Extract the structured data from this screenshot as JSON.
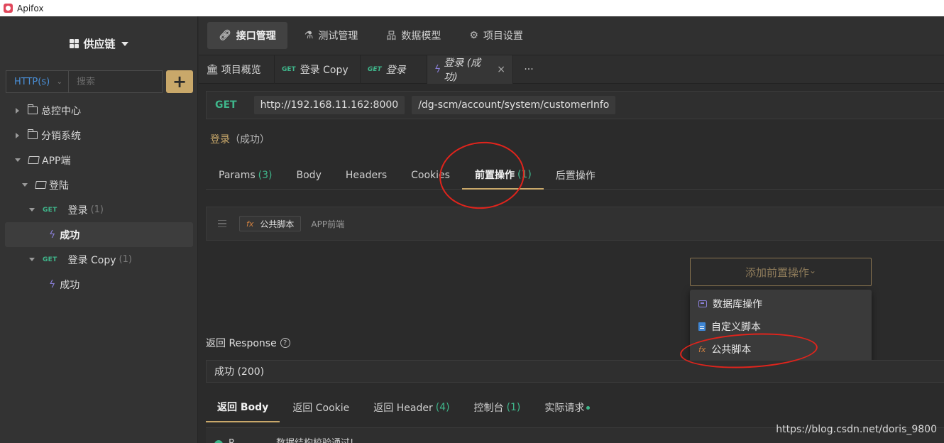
{
  "window": {
    "title": "Apifox"
  },
  "sidebar": {
    "project": "供应链",
    "protocol": "HTTP(s)",
    "search_placeholder": "搜索",
    "add_label": "+",
    "tree": {
      "folder1": "总控中心",
      "folder2": "分销系统",
      "folder3": "APP端",
      "folder4": "登陆",
      "api1": {
        "method": "GET",
        "name": "登录",
        "count": "(1)"
      },
      "case1": "成功",
      "api2": {
        "method": "GET",
        "name": "登录 Copy",
        "count": "(1)"
      },
      "case2": "成功"
    }
  },
  "topnav": {
    "items": [
      "接口管理",
      "测试管理",
      "数据模型",
      "项目设置"
    ]
  },
  "tabs": {
    "overview": "项目概览",
    "tab2": {
      "method": "GET",
      "label": "登录 Copy"
    },
    "tab3": {
      "method": "GET",
      "label": "登录"
    },
    "tab4": {
      "label": "登录 (成功)"
    },
    "more": "···",
    "close": "×"
  },
  "request": {
    "method": "GET",
    "base_url": "http://192.168.11.162:8000",
    "path": "/dg-scm/account/system/customerInfo",
    "name": "登录",
    "case": "（成功）"
  },
  "subtabs": {
    "params": "Params",
    "params_count": "(3)",
    "body": "Body",
    "headers": "Headers",
    "cookies": "Cookies",
    "pre": "前置操作",
    "pre_count": "(1)",
    "post": "后置操作"
  },
  "script": {
    "fx": "fx",
    "name": "公共脚本",
    "desc": "APP前端"
  },
  "add_pre": {
    "label": "添加前置操作",
    "chevron": "⌄",
    "options": [
      "数据库操作",
      "自定义脚本",
      "公共脚本"
    ]
  },
  "response": {
    "title": "返回 Response",
    "help": "?",
    "status": "成功 (200)",
    "tabs": {
      "body": "返回 Body",
      "cookie": "返回 Cookie",
      "header": "返回 Header",
      "header_count": "(4)",
      "console": "控制台",
      "console_count": "(1)",
      "actual": "实际请求"
    },
    "body_preview_a": "R",
    "body_preview_b": "数据结构校验通过!"
  },
  "watermark": "https://blog.csdn.net/doris_9800",
  "colors": {
    "accent": "#c9a86a",
    "get": "#3fb68b",
    "annotation": "#e0241c"
  }
}
